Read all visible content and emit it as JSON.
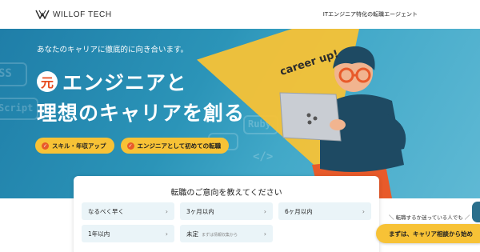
{
  "header": {
    "brand": "WILLOF TECH",
    "tagline": "ITエンジニア特化の転職エージェント"
  },
  "hero": {
    "subtitle": "あなたのキャリアに徹底的に向き合います。",
    "badge": "元",
    "title_line1": "エンジニアと",
    "title_line2": "理想のキャリアを創る",
    "pills": [
      "スキル・年収アップ",
      "エンジニアとして初めての転職"
    ],
    "sign_text": "career up!",
    "bg_words": [
      "SS",
      "Script",
      "Ruby",
      "HP",
      "</>"
    ]
  },
  "panel": {
    "title": "転職のご意向を教えてください",
    "options": [
      {
        "label": "なるべく早く",
        "note": ""
      },
      {
        "label": "3ヶ月以内",
        "note": ""
      },
      {
        "label": "6ヶ月以内",
        "note": ""
      },
      {
        "label": "1年以内",
        "note": ""
      },
      {
        "label": "未定",
        "note": "まずは情報収集から"
      }
    ]
  },
  "cta": {
    "label": "＼ 転職するか迷っている人でも ／",
    "button": "まずは、キャリア相談から始め"
  },
  "colors": {
    "hero_blue": "#2b94b8",
    "accent_yellow": "#f7c236",
    "accent_orange": "#e85a2a"
  }
}
